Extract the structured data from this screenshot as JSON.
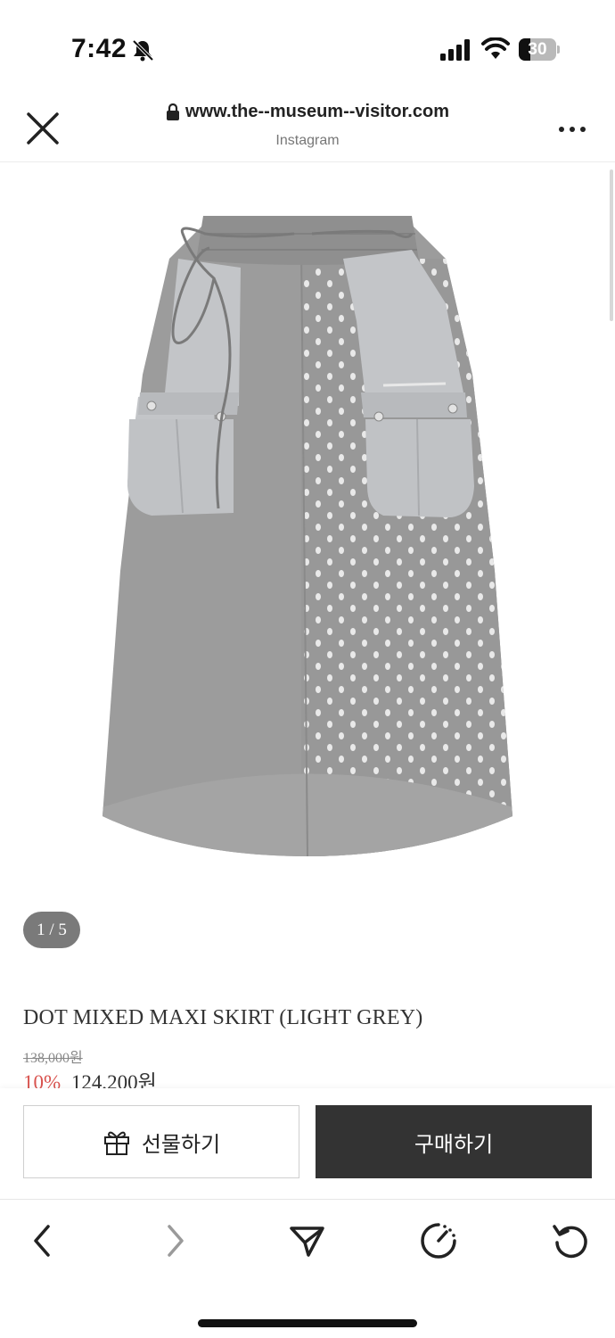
{
  "status_bar": {
    "time": "7:42",
    "battery_level": "30",
    "icons": [
      "bell-slash-icon",
      "signal-icon",
      "wifi-icon",
      "battery-icon"
    ]
  },
  "browser": {
    "url": "www.the--museum--visitor.com",
    "source": "Instagram",
    "icons": [
      "close-icon",
      "lock-icon",
      "more-icon"
    ]
  },
  "product": {
    "image_counter": "1 / 5",
    "title": "DOT MIXED MAXI SKIRT (LIGHT GREY)",
    "original_price": "138,000원",
    "discount": "10%",
    "sale_price": "124,200원"
  },
  "actions": {
    "gift_label": "선물하기",
    "buy_label": "구매하기"
  },
  "toolbar": {
    "icons": [
      "back-icon",
      "forward-icon",
      "share-icon",
      "speed-icon",
      "reload-icon"
    ]
  },
  "colors": {
    "discount": "#d9534f",
    "buy_button": "#333333",
    "skirt_grey": "#9a9a9a"
  }
}
